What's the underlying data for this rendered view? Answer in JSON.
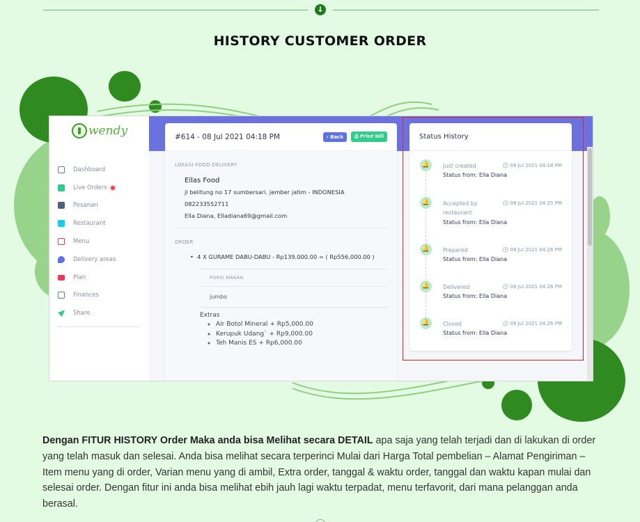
{
  "page": {
    "title": "HISTORY CUSTOMER ORDER",
    "divider_icon": "arrow-down-circle-icon",
    "description_bold": "Dengan FITUR HISTORY Order Maka anda bisa Melihat secara DETAIL",
    "description_rest": " apa saja yang telah terjadi dan di lakukan di order yang telah masuk dan selesai. Anda bisa melihat secara terperinci Mulai dari Harga Total pembelian – Alamat Pengiriman – Item menu yang di order, Varian menu yang di ambil, Extra order, tanggal & waktu order, tanggal dan waktu kapan mulai dan selesai order. Dengan fitur ini anda bisa melihat ebih jauh lagi waktu terpadat, menu terfavorit, dari mana pelanggan anda berasal."
  },
  "app": {
    "logo_text": "wendy",
    "sidebar": {
      "items": [
        {
          "label": "Dashboard",
          "icon": "monitor-icon",
          "color": "#5e72e4"
        },
        {
          "label": "Live Orders",
          "icon": "calendar-icon",
          "color": "#2dce89",
          "badge": true
        },
        {
          "label": "Pesanan",
          "icon": "basket-icon",
          "color": "#525f7f"
        },
        {
          "label": "Restaurant",
          "icon": "store-icon",
          "color": "#11cdef"
        },
        {
          "label": "Menu",
          "icon": "book-icon",
          "color": "#f5365c"
        },
        {
          "label": "Delivery areas",
          "icon": "pin-icon",
          "color": "#5e72e4"
        },
        {
          "label": "Plan",
          "icon": "credit-card-icon",
          "color": "#f5365c"
        },
        {
          "label": "Finances",
          "icon": "money-icon",
          "color": "#5e72e4"
        },
        {
          "label": "Share",
          "icon": "send-icon",
          "color": "#2dce89"
        }
      ]
    },
    "order": {
      "title": "#614 - 08 Jul 2021 04:18 PM",
      "back_label": "Back",
      "print_label": "Print bill",
      "delivery_label": "LOKASI FOOD DELIVERY",
      "customer_name": "Ellas Food",
      "address": "jl belitung no 17 sumbersari. jember jatim - INDONESIA",
      "phone": "082233552711",
      "contact": "Ella Diana, Elladiana69@gmail.com",
      "order_label": "ORDER",
      "item": "4 X GURAME DABU-DABU - Rp139,000.00 = ( Rp556,000.00 )",
      "porsi_label": "PORSI MAKAN",
      "porsi_value": "jumbo",
      "extras_label": "Extras",
      "extras": [
        "Air Botol Mineral + Rp5,000.00",
        "Kerupuk Udang` + Rp9,000.00",
        "Teh Manis ES + Rp6,000.00"
      ]
    },
    "status": {
      "title": "Status History",
      "events": [
        {
          "title": "Just created",
          "time": "08 Jul 2021 04:18 PM",
          "from": "Status from: Ella Diana"
        },
        {
          "title": "Accepted by restaurant",
          "time": "08 Jul 2021 04:25 PM",
          "from": "Status from: Ella Diana"
        },
        {
          "title": "Prepared",
          "time": "08 Jul 2021 04:26 PM",
          "from": "Status from: Ella Diana"
        },
        {
          "title": "Delivered",
          "time": "08 Jul 2021 04:26 PM",
          "from": "Status from: Ella Diana"
        },
        {
          "title": "Closed",
          "time": "08 Jul 2021 04:26 PM",
          "from": "Status from: Ella Diana"
        }
      ]
    }
  },
  "colors": {
    "accent_green": "#2f8a1f",
    "background": "#e3fbe3",
    "banner": "#6b72e0",
    "highlight": "#e0242c"
  }
}
